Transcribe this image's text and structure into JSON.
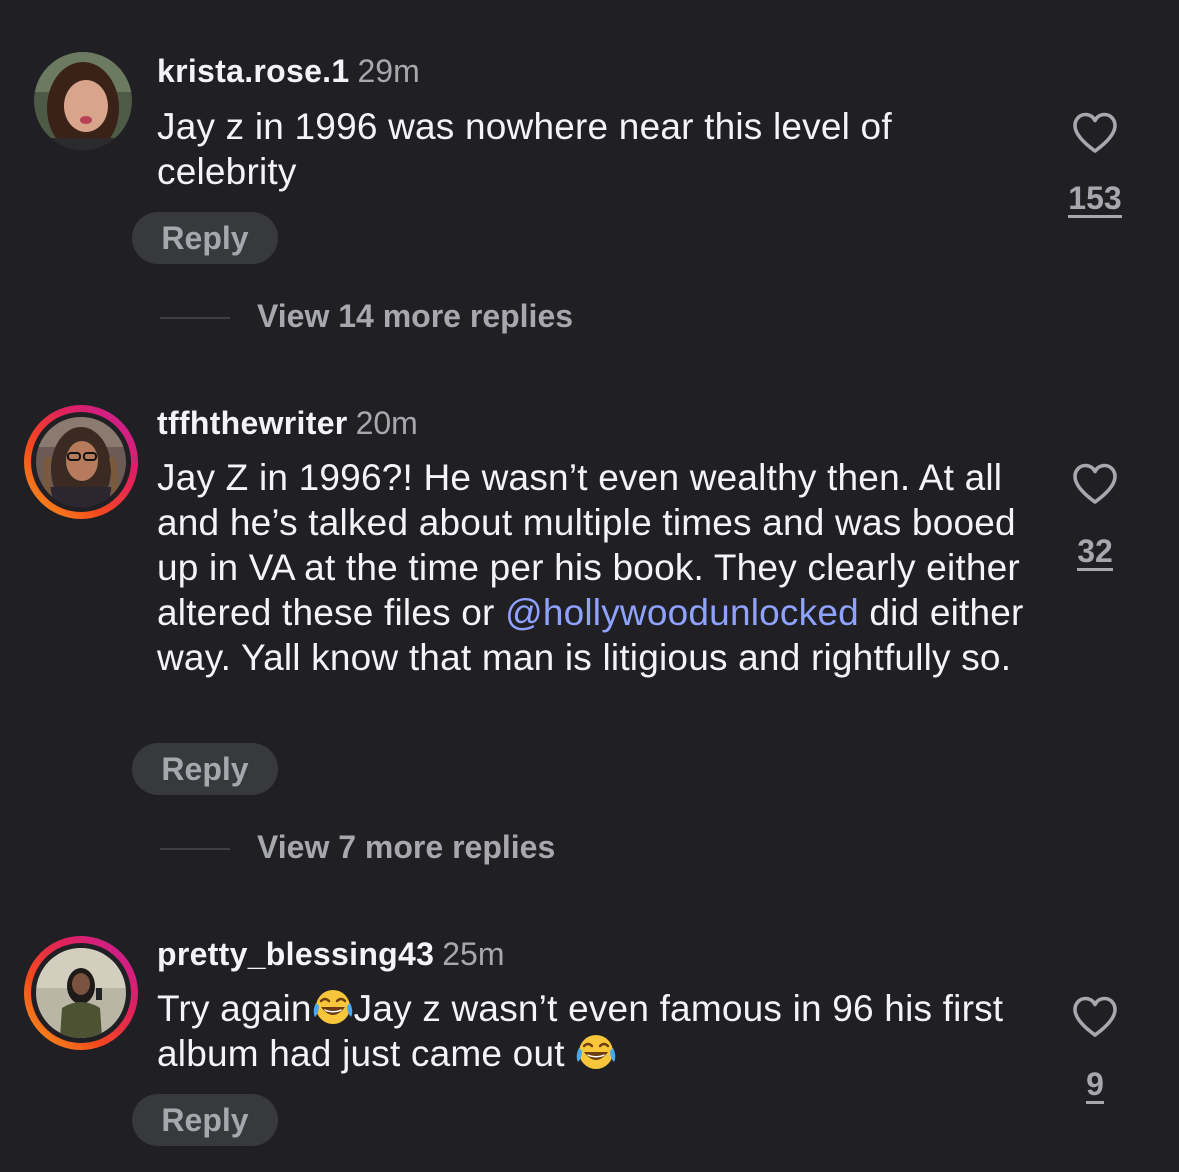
{
  "comments": [
    {
      "username": "krista.rose.1",
      "time": "29m",
      "text": "Jay z in 1996 was nowhere near this level of celebrity",
      "reply_label": "Reply",
      "likes": "153",
      "view_more": "View 14 more replies",
      "avatar_story_ring": false,
      "avatar_icon": "profile-photo"
    },
    {
      "username": "tffhthewriter",
      "time": "20m",
      "text_before_mention": "Jay Z in 1996?! He wasn’t even wealthy then. At all and he’s talked about multiple times and was booed up in VA at the time per his book. They clearly either altered these files or ",
      "mention": "@hollywoodunlocked",
      "text_after_mention": " did either way. Yall know that man is litigious and rightfully so.",
      "reply_label": "Reply",
      "likes": "32",
      "view_more": "View 7 more replies",
      "avatar_story_ring": true,
      "avatar_icon": "profile-photo"
    },
    {
      "username": "pretty_blessing43",
      "time": "25m",
      "text_part1": "Try again",
      "text_part2": "Jay z wasn’t even famous in 96 his first album had just came out ",
      "emoji": "face-with-tears-of-joy",
      "reply_label": "Reply",
      "likes": "9",
      "avatar_story_ring": true,
      "avatar_icon": "profile-photo"
    }
  ],
  "icons": {
    "like": "heart-outline-icon"
  },
  "colors": {
    "background": "#202024",
    "text_primary": "#f4f4f6",
    "text_secondary": "#a6a8ae",
    "reply_pill": "#38393d",
    "mention": "#8fa2ff",
    "story_ring_start": "#f8a21b",
    "story_ring_end": "#c21fa8"
  }
}
